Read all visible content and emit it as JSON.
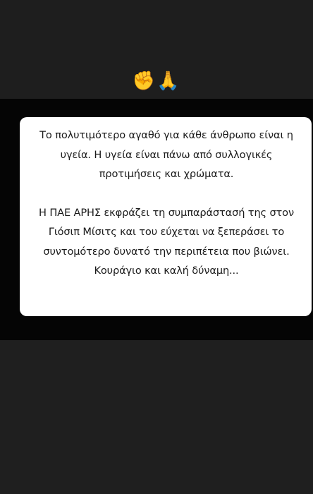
{
  "story": {
    "reactions": "✊🙏",
    "reaction_icons": [
      "raised-fist-icon",
      "folded-hands-icon"
    ],
    "paragraphs": [
      "Το πολυτιμότερο αγαθό για κάθε άνθρωπο είναι η υγεία. Η υγεία είναι πάνω από συλλογικές προτιμήσεις και χρώματα.",
      "Η ΠΑΕ ΑΡΗΣ εκφράζει τη συμπαράστασή της στον Γιόσιπ Μίσιτς και του εύχεται να ξεπεράσει το συντομότερο δυνατό την περιπέτεια που βιώνει. Κουράγιο και καλή δύναμη..."
    ]
  },
  "colors": {
    "background": "#1f1f1f",
    "strip": "#050505",
    "card": "#ffffff",
    "text": "#1a1a1a"
  }
}
